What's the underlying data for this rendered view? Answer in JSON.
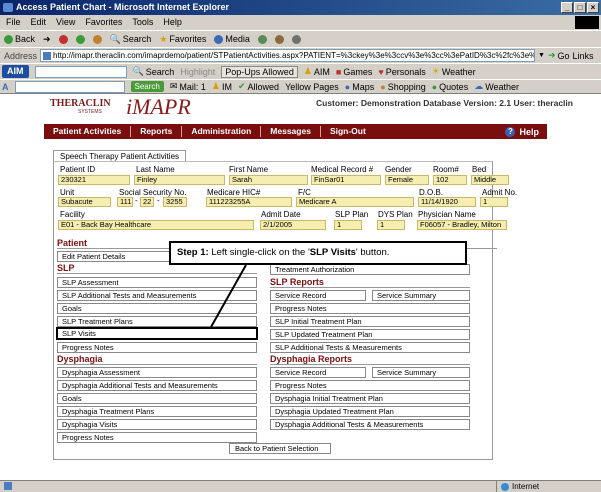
{
  "window": {
    "title": "Access Patient Chart - Microsoft Internet Explorer"
  },
  "menu": [
    "File",
    "Edit",
    "View",
    "Favorites",
    "Tools",
    "Help"
  ],
  "toolbar": {
    "back": "Back",
    "search": "Search",
    "favorites": "Favorites",
    "media": "Media"
  },
  "address": {
    "label": "Address",
    "url": "http://imapr.theraclin.com/imaprdemo/patient/STPatientActivities.aspx?PATIENT=%3ckey%3e%3ccv%3e%3cc%3ePatID%3c%2fc%3e%3cv%3e2303",
    "go": "Go",
    "links": "Links"
  },
  "aimbar": {
    "aim": "AIM",
    "search": "Search",
    "highlight": "Highlight",
    "popups": "Pop-Ups Allowed",
    "aim_menu": "AIM",
    "games": "Games",
    "personals": "Personals",
    "weather": "Weather"
  },
  "linksbar": {
    "search": "Search",
    "mail": "Mail: 1",
    "im": "IM",
    "allowed": "Allowed",
    "yellow": "Yellow Pages",
    "maps": "Maps",
    "shopping": "Shopping",
    "quotes": "Quotes",
    "weather": "Weather"
  },
  "status": {
    "zone": "Internet"
  },
  "app": {
    "logo_thera": "THERACLIN",
    "logo_systems": "SYSTEMS",
    "logo_imapr": "iMAPR",
    "customer": "Customer: Demonstration Database Version: 2.1 User: theraclin",
    "nav": [
      "Patient Activities",
      "Reports",
      "Administration",
      "Messages",
      "Sign-Out"
    ],
    "help": "Help",
    "tab": "Speech Therapy Patient Activities"
  },
  "patient": {
    "labels": {
      "id": "Patient ID",
      "last": "Last Name",
      "first": "First Name",
      "mrn": "Medical Record #",
      "gender": "Gender",
      "room": "Room#",
      "bed": "Bed",
      "unit": "Unit",
      "ssn": "Social Security No.",
      "hic": "Medicare HIC#",
      "fc": "F/C",
      "dob": "D.O.B.",
      "admit_no": "Admit No.",
      "facility": "Facility",
      "admit_date": "Admit Date",
      "slp_plan": "SLP Plan",
      "dys_plan": "DYS Plan",
      "physician": "Physician Name"
    },
    "values": {
      "id": "230321",
      "last": "Finley",
      "first": "Sarah",
      "mrn": "FinSar01",
      "gender": "Female",
      "room": "102",
      "bed": "Middle",
      "unit": "Subacute",
      "ssn1": "111",
      "ssn2": "22",
      "ssn3": "3255",
      "hic": "111223255A",
      "fc": "Medicare A",
      "dob": "11/14/1920",
      "admit_no": "1",
      "facility": "E01 - Back Bay Healthcare",
      "admit_date": "2/1/2005",
      "slp_plan": "1",
      "dys_plan": "1",
      "physician": "F06057 - Bradley, Milton"
    }
  },
  "sections": {
    "patient": "Patient",
    "slp": "SLP",
    "slp_reports": "SLP Reports",
    "dysphagia": "Dysphagia",
    "dysphagia_reports": "Dysphagia Reports"
  },
  "buttons": {
    "edit_patient": "Edit Patient Details",
    "treatment_auth": "Treatment Authorization",
    "slp_left": [
      "SLP Assessment",
      "SLP Additional Tests and Measurements",
      "Goals",
      "SLP Treatment Plans",
      "SLP Visits",
      "Progress Notes"
    ],
    "slp_service_record": "Service Record",
    "slp_service_summary": "Service Summary",
    "slp_right": [
      "Progress Notes",
      "SLP Initial Treatment Plan",
      "SLP Updated Treatment Plan",
      "SLP Additional Tests & Measurements"
    ],
    "dys_left": [
      "Dysphagia Assessment",
      "Dysphagia Additional Tests and Measurements",
      "Goals",
      "Dysphagia Treatment Plans",
      "Dysphagia Visits",
      "Progress Notes"
    ],
    "dys_service_record": "Service Record",
    "dys_service_summary": "Service Summary",
    "dys_right": [
      "Progress Notes",
      "Dysphagia Initial Treatment Plan",
      "Dysphagia Updated Treatment Plan",
      "Dysphagia Additional Tests & Measurements"
    ],
    "back": "Back to Patient Selection"
  },
  "callout": {
    "prefix": "Step 1:",
    "text": " Left single-click on the '",
    "target": "SLP Visits",
    "suffix": "' button."
  }
}
